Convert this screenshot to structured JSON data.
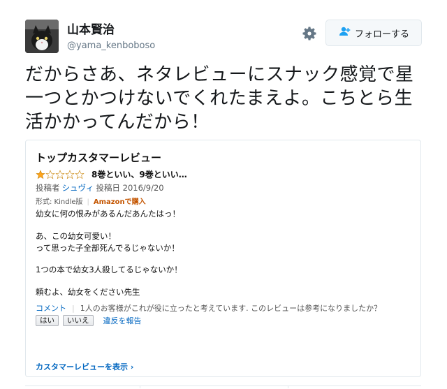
{
  "user": {
    "display_name": "山本賢治",
    "handle": "@yama_kenboboso"
  },
  "follow_button": {
    "label": "フォローする",
    "icon": "add-user-icon"
  },
  "settings_icon": "gear-icon",
  "tweet": {
    "lines": [
      "だからさあ、ネタレビューにスナック感覚で星",
      "一つとかつけないでくれたまえよ。こちとら生",
      "活かかってんだから！"
    ]
  },
  "review_card": {
    "title": "トップカスタマーレビュー",
    "rating": 1,
    "rating_max": 5,
    "star_color": "#ffa41c",
    "review_title": "8巻といい、9巻といい…",
    "byline": {
      "prefix": "投稿者",
      "author": "シュヴィ",
      "date_text": "投稿日 2016/9/20"
    },
    "format": {
      "label": "形式: Kindle版",
      "purchase": "Amazonで購入"
    },
    "body": [
      "幼女に何の恨みがあるんだあんたはっ！",
      "",
      "あ、この幼女可愛い！",
      "って思った子全部死んでるじゃないか！",
      "",
      "1つの本で幼女3人殺してるじゃないか！",
      "",
      "頼むよ、幼女をください先生"
    ],
    "comment_link": "コメント",
    "helpful_text": "1人のお客様がこれが役に立ったと考えています. このレビューは参考になりましたか？",
    "yes_label": "はい",
    "no_label": "いいえ",
    "report_link": "違反を報告",
    "more_link": "カスタマーレビューを表示 ›"
  }
}
